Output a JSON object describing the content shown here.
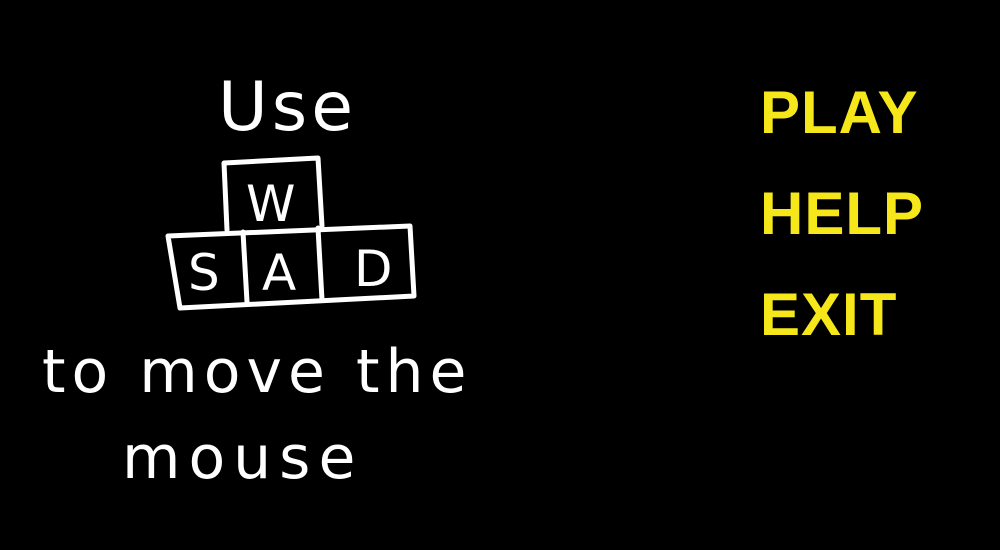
{
  "instructions": {
    "line1": "Use",
    "keys": {
      "up": "W",
      "left": "S",
      "middle": "A",
      "right": "D"
    },
    "line2": "to move the",
    "line3": "mouse"
  },
  "menu": {
    "play_label": "PLAY",
    "help_label": "HELP",
    "exit_label": "EXIT"
  },
  "colors": {
    "background": "#000000",
    "menu_text": "#f5e71a",
    "hand_text": "#ffffff"
  }
}
